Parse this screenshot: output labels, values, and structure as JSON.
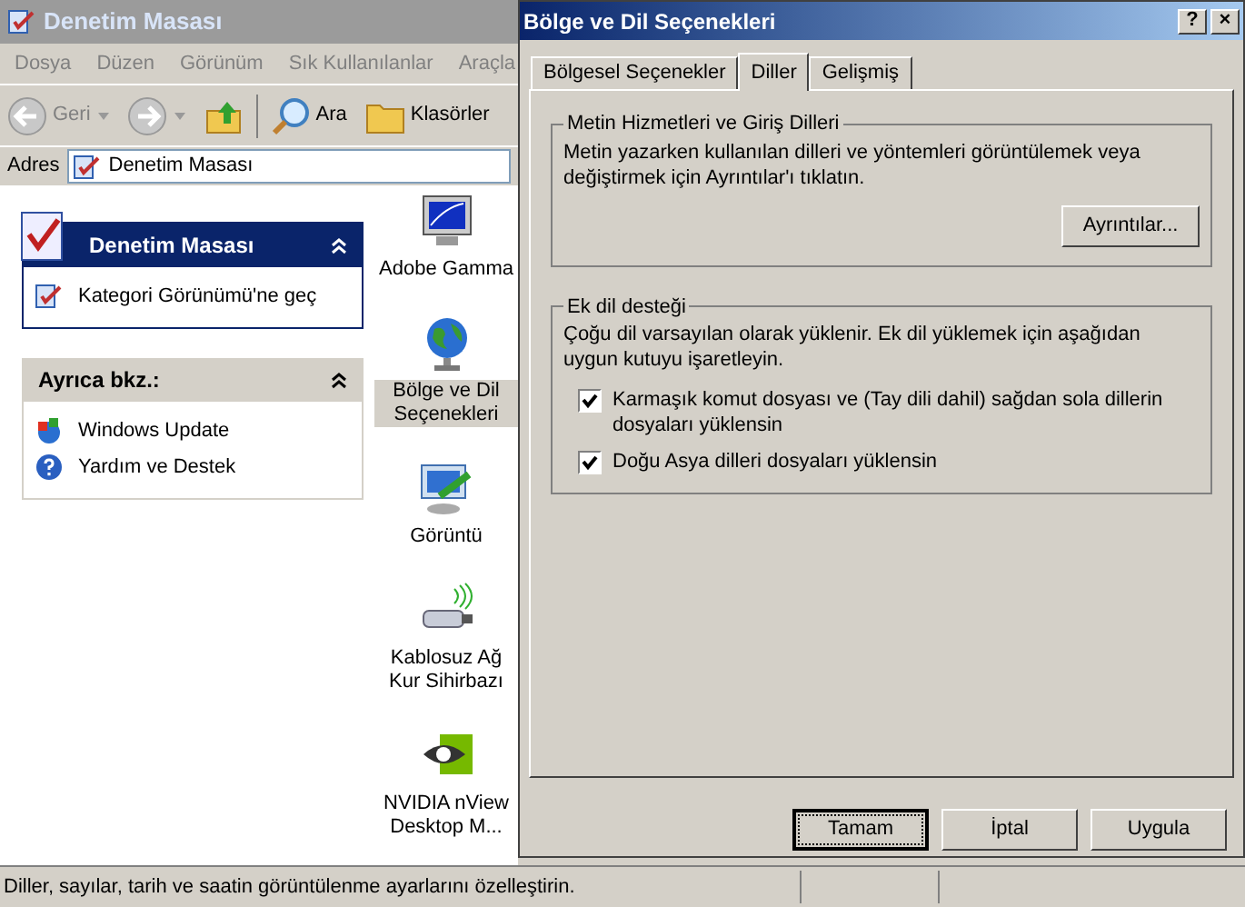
{
  "explorer": {
    "title": "Denetim Masası",
    "menu": [
      "Dosya",
      "Düzen",
      "Görünüm",
      "Sık Kullanılanlar",
      "Araçla"
    ],
    "toolbar": {
      "back": "Geri",
      "search": "Ara",
      "folders": "Klasörler"
    },
    "address": {
      "label": "Adres",
      "value": "Denetim Masası"
    },
    "panels": [
      {
        "kind": "primary",
        "title": "Denetim Masası",
        "expanded": true,
        "links": [
          {
            "kind": "control",
            "label": "Kategori Görünümü'ne geç"
          }
        ]
      },
      {
        "kind": "secondary",
        "title": "Ayrıca bkz.:",
        "expanded": true,
        "links": [
          {
            "kind": "update",
            "label": "Windows Update"
          },
          {
            "kind": "help",
            "label": "Yardım ve Destek"
          }
        ]
      }
    ],
    "items": [
      {
        "kind": "monitor",
        "label": "Adobe Gamma",
        "selected": false
      },
      {
        "kind": "globe",
        "label": "Bölge ve Dil Seçenekleri",
        "selected": true
      },
      {
        "kind": "display",
        "label": "Görüntü",
        "selected": false
      },
      {
        "kind": "wireless",
        "label": "Kablosuz Ağ Kur Sihirbazı",
        "selected": false
      },
      {
        "kind": "nvidia",
        "label": "NVIDIA nView Desktop M...",
        "selected": false
      }
    ],
    "status_bar": "Diller, sayılar, tarih ve saatin görüntülenme ayarlarını özelleştirin."
  },
  "dialog": {
    "title": "Bölge ve Dil Seçenekleri",
    "title_buttons": [
      "?",
      "×"
    ],
    "tabs": [
      {
        "label": "Bölgesel Seçenekler",
        "selected": false
      },
      {
        "label": "Diller",
        "selected": true
      },
      {
        "label": "Gelişmiş",
        "selected": false
      }
    ],
    "groups": [
      {
        "title": "Metin Hizmetleri ve Giriş Dilleri",
        "text": "Metin yazarken kullanılan dilleri ve yöntemleri görüntülemek veya değiştirmek için Ayrıntılar'ı tıklatın.",
        "button": "Ayrıntılar..."
      },
      {
        "title": "Ek dil desteği",
        "text": "Çoğu dil varsayılan olarak yüklenir. Ek dil yüklemek için aşağıdan uygun kutuyu işaretleyin.",
        "checkboxes": [
          {
            "label": "Karmaşık komut dosyası ve (Tay dili dahil) sağdan sola dillerin dosyaları yüklensin",
            "checked": true
          },
          {
            "label": "Doğu Asya dilleri dosyaları yüklensin",
            "checked": true
          }
        ]
      }
    ],
    "buttons": [
      {
        "label": "Tamam",
        "default": true
      },
      {
        "label": "İptal",
        "default": false
      },
      {
        "label": "Uygula",
        "default": false
      }
    ]
  }
}
